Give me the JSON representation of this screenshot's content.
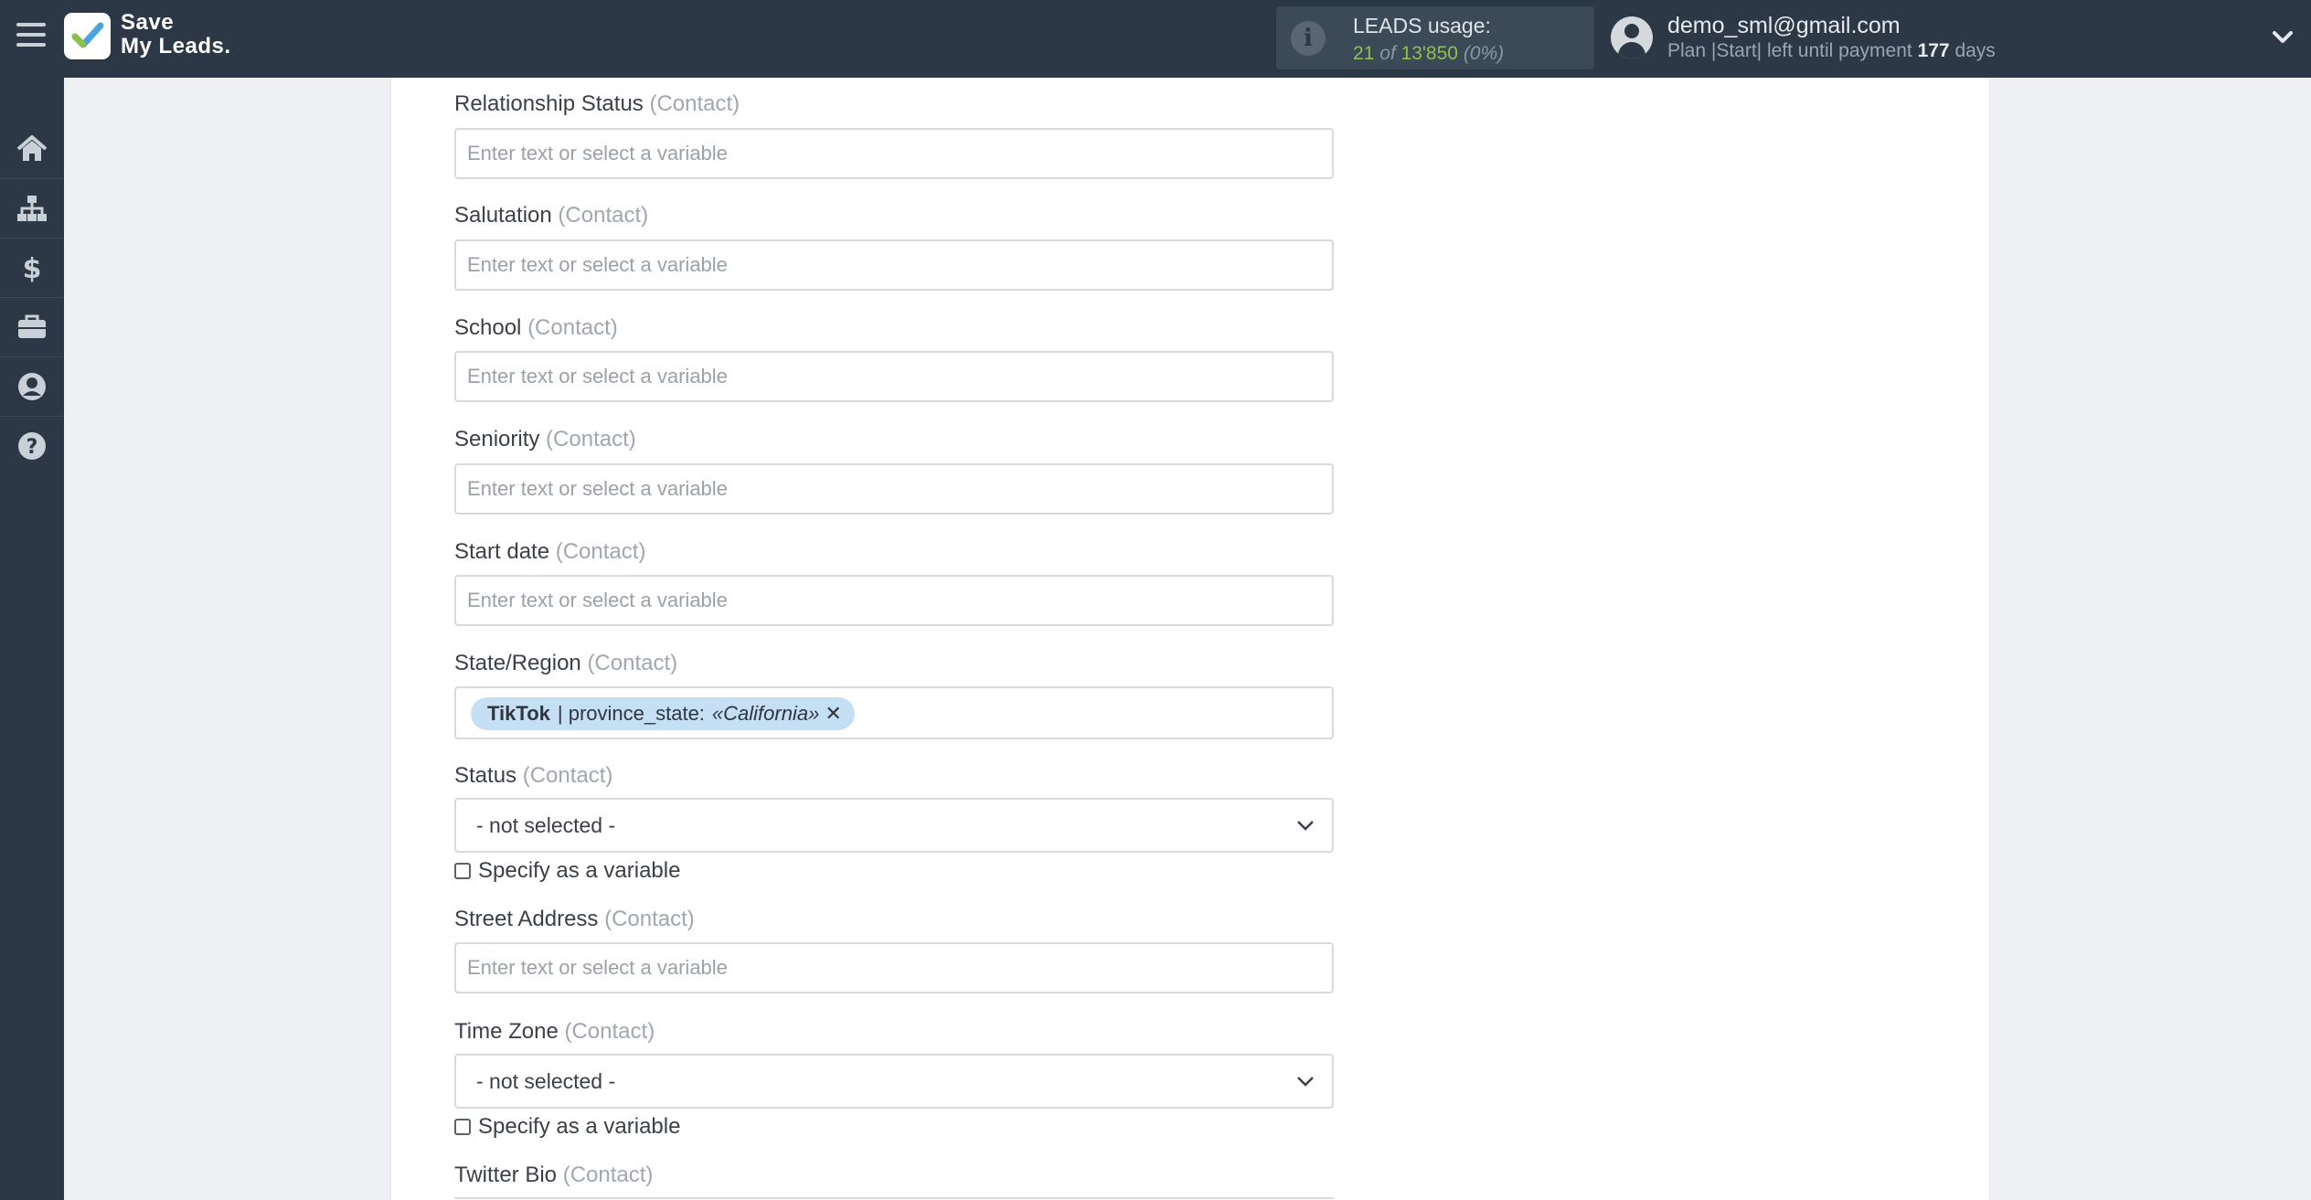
{
  "app": {
    "logo_line1": "Save",
    "logo_line2": "My Leads."
  },
  "usage": {
    "title": "LEADS usage:",
    "used": "21",
    "of": "of",
    "total": "13'850",
    "percent": "(0%)"
  },
  "user": {
    "email": "demo_sml@gmail.com",
    "plan_prefix": "Plan |Start| left until payment",
    "days_number": "177",
    "days_suffix": "days"
  },
  "sidebar": {
    "items": [
      {
        "icon": "home-icon"
      },
      {
        "icon": "sitemap-icon"
      },
      {
        "icon": "dollar-icon"
      },
      {
        "icon": "briefcase-icon"
      },
      {
        "icon": "user-circle-icon"
      },
      {
        "icon": "question-circle-icon"
      }
    ]
  },
  "form": {
    "placeholder": "Enter text or select a variable",
    "contact_suffix": "(Contact)",
    "fields": {
      "relationship_status": "Relationship Status",
      "salutation": "Salutation",
      "school": "School",
      "seniority": "Seniority",
      "start_date": "Start date",
      "state_region": "State/Region",
      "status": "Status",
      "street_address": "Street Address",
      "time_zone": "Time Zone",
      "twitter_bio": "Twitter Bio"
    },
    "state_tag": {
      "source": "TikTok",
      "separator": "|",
      "field": "province_state:",
      "value": "«California»"
    },
    "status_value": "- not selected -",
    "time_zone_value": "- not selected -",
    "specify_variable": "Specify as a variable"
  },
  "colors": {
    "topbar": "#2c3845",
    "accent_green": "#8bc34a",
    "tag_bg": "#c5dff5"
  }
}
